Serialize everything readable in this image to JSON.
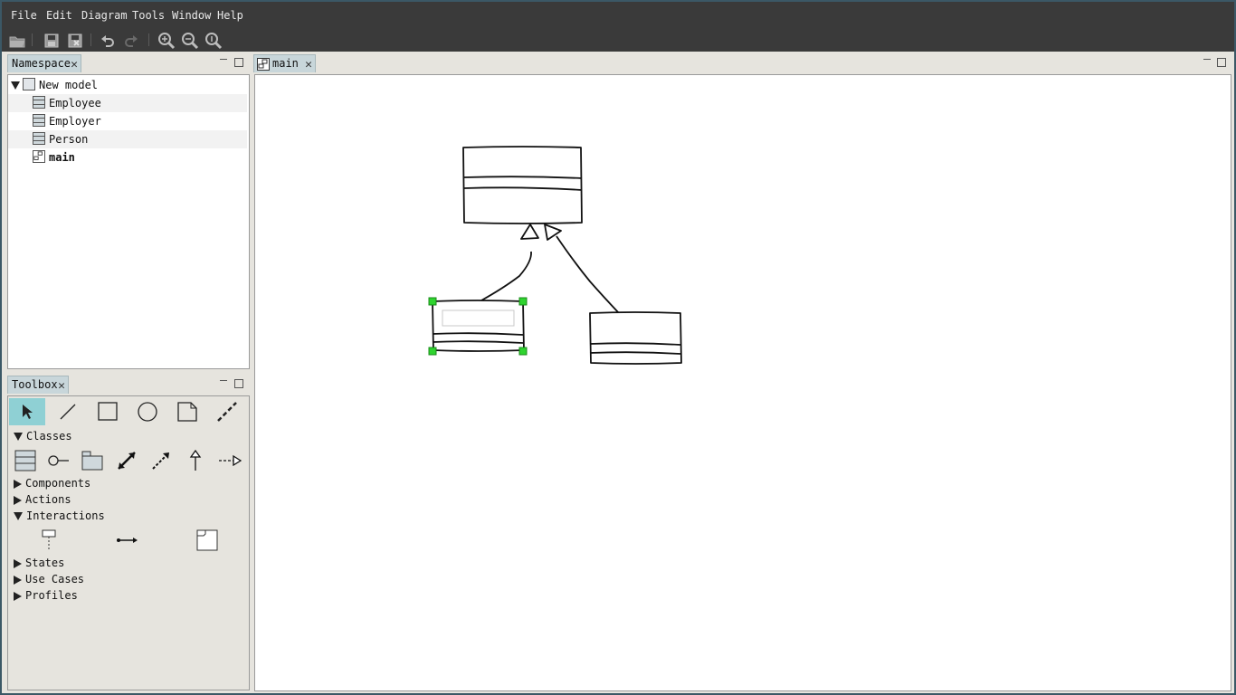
{
  "menubar": {
    "items": [
      "File",
      "Edit",
      "Diagram",
      "Tools",
      "Window",
      "Help"
    ]
  },
  "toolbar": {
    "buttons": [
      "open-icon",
      "save-icon",
      "save-as-icon",
      "undo-icon",
      "redo-icon",
      "zoom-in-icon",
      "zoom-out-icon",
      "zoom-reset-icon"
    ]
  },
  "namespace": {
    "tab_label": "Namespace",
    "tree": {
      "root": "New model",
      "items": [
        "Employee",
        "Employer",
        "Person",
        "main"
      ]
    }
  },
  "toolbox": {
    "tab_label": "Toolbox",
    "sections": {
      "classes": "Classes",
      "components": "Components",
      "actions": "Actions",
      "interactions": "Interactions",
      "states": "States",
      "use_cases": "Use Cases",
      "profiles": "Profiles"
    },
    "general_tools": [
      "pointer-icon",
      "line-icon",
      "box-icon",
      "ellipse-icon",
      "comment-icon",
      "comment-line-icon"
    ],
    "class_tools": [
      "class-icon",
      "interface-icon",
      "package-icon",
      "association-icon",
      "dependency-icon",
      "generalization-icon",
      "implementation-icon"
    ],
    "interaction_tools": [
      "lifeline-icon",
      "message-icon",
      "interaction-icon"
    ]
  },
  "editor": {
    "tab_label": "main"
  },
  "colors": {
    "selected_tool": "#8fd0d4",
    "handle": "#2fd42f",
    "chrome": "#3a3a3a"
  }
}
